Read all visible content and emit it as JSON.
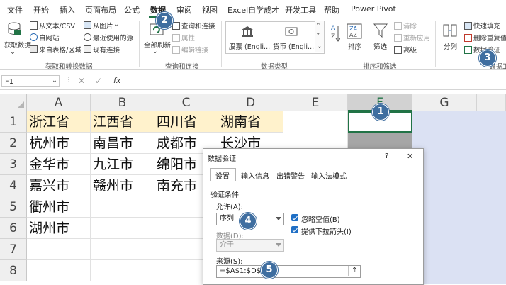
{
  "tabs": [
    "文件",
    "开始",
    "插入",
    "页面布局",
    "公式",
    "数据",
    "审阅",
    "视图",
    "Excel自学成才",
    "开发工具",
    "帮助",
    "Power Pivot"
  ],
  "ribbon": {
    "get_data": "获取数据",
    "from_text_csv": "从文本/CSV",
    "from_web": "自网站",
    "from_table": "来自表格/区域",
    "from_picture": "从图片",
    "recent_sources": "最近使用的源",
    "existing_connections": "现有连接",
    "group_get_transform": "获取和转换数据",
    "refresh_all": "全部刷新",
    "queries_connections": "查询和连接",
    "properties": "属性",
    "edit_links": "编辑链接",
    "group_queries": "查询和连接",
    "stocks": "股票 (Engli...",
    "currencies": "货币 (Engli...",
    "group_data_types": "数据类型",
    "sort": "排序",
    "filter": "筛选",
    "clear": "清除",
    "reapply": "重新应用",
    "advanced": "高级",
    "group_sort_filter": "排序和筛选",
    "text_to_columns": "分列",
    "flash_fill": "快速填充",
    "remove_duplicates": "删除重复值",
    "data_validation": "数据验证",
    "group_data_tools": "数据工"
  },
  "formula_bar": {
    "name_box": "F1",
    "fx": "fx"
  },
  "columns": [
    "A",
    "B",
    "C",
    "D",
    "E",
    "F",
    "G"
  ],
  "rows": [
    "1",
    "2",
    "3",
    "4",
    "5",
    "6",
    "7",
    "8"
  ],
  "cells": [
    [
      "浙江省",
      "江西省",
      "四川省",
      "湖南省"
    ],
    [
      "杭州市",
      "南昌市",
      "成都市",
      "长沙市"
    ],
    [
      "金华市",
      "九江市",
      "绵阳市",
      ""
    ],
    [
      "嘉兴市",
      "赣州市",
      "南充市",
      ""
    ],
    [
      "衢州市",
      "",
      "",
      ""
    ],
    [
      "湖州市",
      "",
      "",
      ""
    ]
  ],
  "badges": [
    "1",
    "2",
    "3",
    "4",
    "5"
  ],
  "dialog": {
    "title": "数据验证",
    "help": "?",
    "close": "✕",
    "tabs": [
      "设置",
      "输入信息",
      "出错警告",
      "输入法模式"
    ],
    "section": "验证条件",
    "allow_label": "允许(A):",
    "allow_value": "序列",
    "ignore_blank": "忽略空值(B)",
    "dropdown_arrow": "提供下拉箭头(I)",
    "data_label": "数据(D):",
    "data_value": "介于",
    "source_label": "来源(S):",
    "source_value": "=$A$1:$D$1"
  },
  "colors": {
    "accent": "#217346",
    "badge": "#3f6ea0",
    "header_fill": "#fff2cc",
    "selection": "#dbe1f3"
  }
}
